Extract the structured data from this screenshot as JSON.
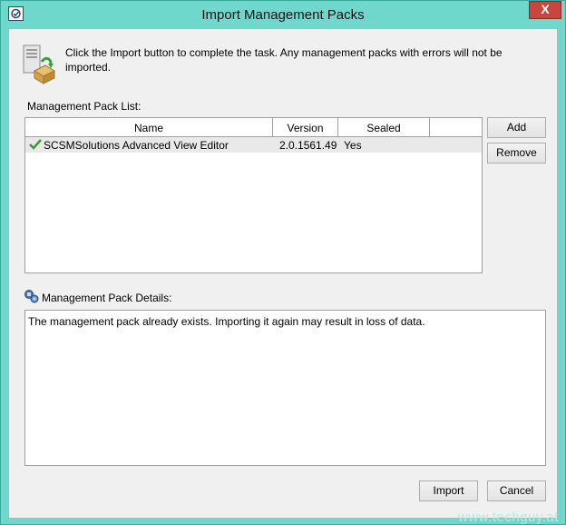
{
  "window": {
    "title": "Import Management Packs",
    "close_label": "X"
  },
  "instruction": "Click the Import button to complete the task. Any management packs with errors will not be imported.",
  "list": {
    "label": "Management Pack List:",
    "columns": [
      "Name",
      "Version",
      "Sealed",
      ""
    ],
    "rows": [
      {
        "status_icon": "check-icon",
        "name": "SCSMSolutions Advanced View Editor",
        "version": "2.0.1561.49",
        "sealed": "Yes"
      }
    ],
    "add_label": "Add",
    "remove_label": "Remove"
  },
  "details": {
    "label": "Management Pack Details:",
    "text": "The management pack already exists. Importing it again may result in loss of data."
  },
  "buttons": {
    "import_label": "Import",
    "cancel_label": "Cancel"
  },
  "watermark": "www.techguy.at"
}
